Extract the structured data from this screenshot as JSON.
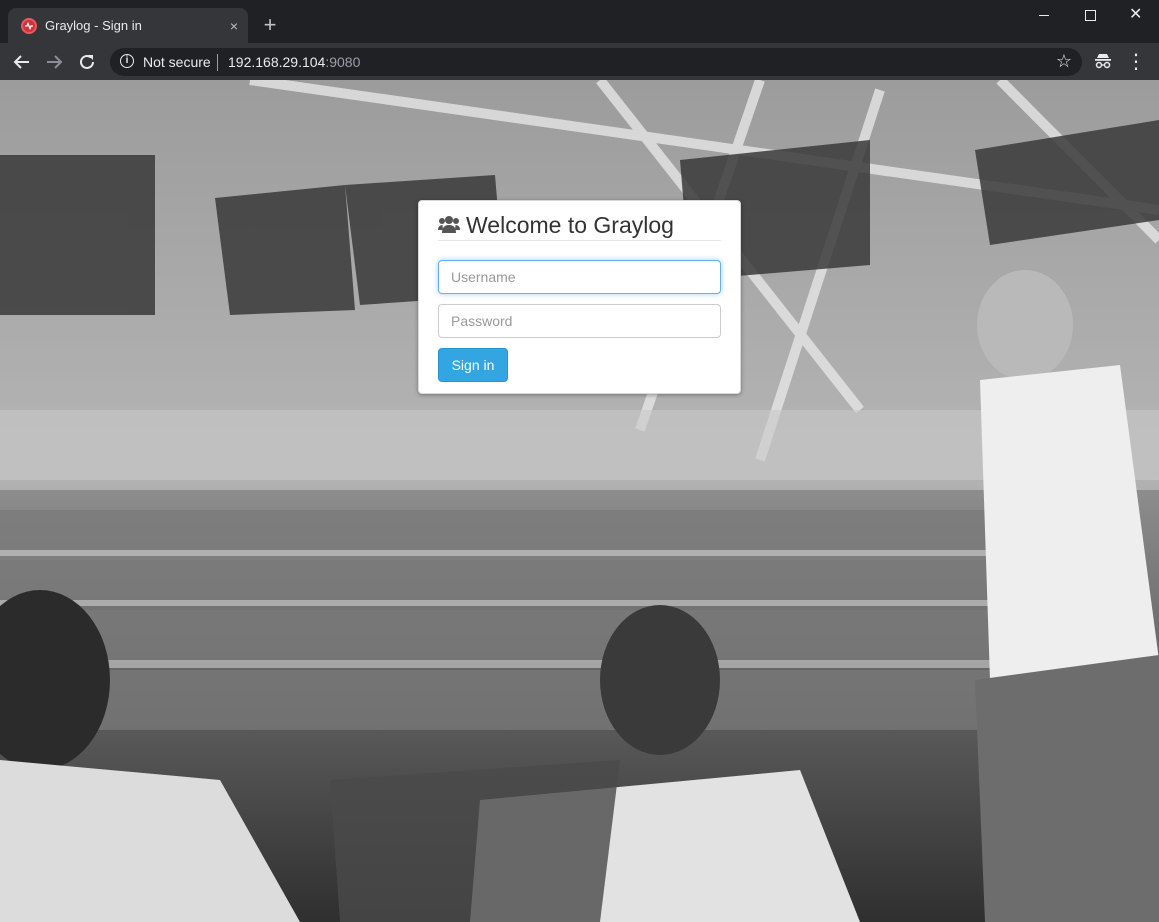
{
  "browser": {
    "tab_title": "Graylog - Sign in",
    "tab_close": "×",
    "new_tab": "+",
    "security_label": "Not secure",
    "url_host": "192.168.29.104",
    "url_port": ":9080",
    "icons": {
      "favicon": "graylog-favicon",
      "back": "back-arrow-icon",
      "forward": "forward-arrow-icon",
      "reload": "reload-icon",
      "info": "info-icon",
      "bookmark": "star-icon",
      "extension": "incognito-extension-icon",
      "menu": "kebab-menu-icon"
    }
  },
  "login": {
    "title": "Welcome to Graylog",
    "username_placeholder": "Username",
    "password_placeholder": "Password",
    "signin_label": "Sign in",
    "accent_color": "#33a5e2"
  }
}
